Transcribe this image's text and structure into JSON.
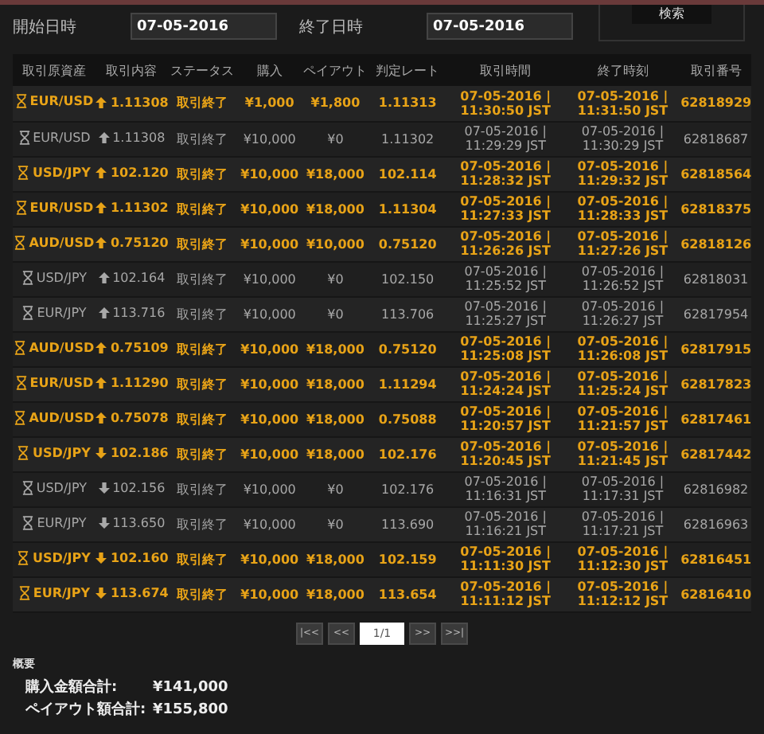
{
  "filters": [
    {
      "label": "開始日時",
      "value": "07-05-2016"
    },
    {
      "label": "終了日時",
      "value": "07-05-2016"
    }
  ],
  "search_button": "検索",
  "table": {
    "columns": [
      "取引原資産",
      "取引内容",
      "ステータス",
      "購入",
      "ペイアウト",
      "判定レート",
      "取引時間",
      "終了時刻",
      "取引番号"
    ],
    "rows": [
      {
        "won": true,
        "up": true,
        "asset": "EUR/USD",
        "strike": "1.11308",
        "status": "取引終了",
        "purchase": "¥1,000",
        "payout": "¥1,800",
        "rate": "1.11313",
        "trade_time": [
          "07-05-2016 |",
          "11:30:50 JST"
        ],
        "end_time": [
          "07-05-2016 |",
          "11:31:50 JST"
        ],
        "id": "62818929"
      },
      {
        "won": false,
        "up": true,
        "asset": "EUR/USD",
        "strike": "1.11308",
        "status": "取引終了",
        "purchase": "¥10,000",
        "payout": "¥0",
        "rate": "1.11302",
        "trade_time": [
          "07-05-2016 |",
          "11:29:29 JST"
        ],
        "end_time": [
          "07-05-2016 |",
          "11:30:29 JST"
        ],
        "id": "62818687"
      },
      {
        "won": true,
        "up": true,
        "asset": "USD/JPY",
        "strike": "102.120",
        "status": "取引終了",
        "purchase": "¥10,000",
        "payout": "¥18,000",
        "rate": "102.114",
        "trade_time": [
          "07-05-2016 |",
          "11:28:32 JST"
        ],
        "end_time": [
          "07-05-2016 |",
          "11:29:32 JST"
        ],
        "id": "62818564"
      },
      {
        "won": true,
        "up": true,
        "asset": "EUR/USD",
        "strike": "1.11302",
        "status": "取引終了",
        "purchase": "¥10,000",
        "payout": "¥18,000",
        "rate": "1.11304",
        "trade_time": [
          "07-05-2016 |",
          "11:27:33 JST"
        ],
        "end_time": [
          "07-05-2016 |",
          "11:28:33 JST"
        ],
        "id": "62818375"
      },
      {
        "won": true,
        "up": true,
        "asset": "AUD/USD",
        "strike": "0.75120",
        "status": "取引終了",
        "purchase": "¥10,000",
        "payout": "¥10,000",
        "rate": "0.75120",
        "trade_time": [
          "07-05-2016 |",
          "11:26:26 JST"
        ],
        "end_time": [
          "07-05-2016 |",
          "11:27:26 JST"
        ],
        "id": "62818126"
      },
      {
        "won": false,
        "up": true,
        "asset": "USD/JPY",
        "strike": "102.164",
        "status": "取引終了",
        "purchase": "¥10,000",
        "payout": "¥0",
        "rate": "102.150",
        "trade_time": [
          "07-05-2016 |",
          "11:25:52 JST"
        ],
        "end_time": [
          "07-05-2016 |",
          "11:26:52 JST"
        ],
        "id": "62818031"
      },
      {
        "won": false,
        "up": true,
        "asset": "EUR/JPY",
        "strike": "113.716",
        "status": "取引終了",
        "purchase": "¥10,000",
        "payout": "¥0",
        "rate": "113.706",
        "trade_time": [
          "07-05-2016 |",
          "11:25:27 JST"
        ],
        "end_time": [
          "07-05-2016 |",
          "11:26:27 JST"
        ],
        "id": "62817954"
      },
      {
        "won": true,
        "up": true,
        "asset": "AUD/USD",
        "strike": "0.75109",
        "status": "取引終了",
        "purchase": "¥10,000",
        "payout": "¥18,000",
        "rate": "0.75120",
        "trade_time": [
          "07-05-2016 |",
          "11:25:08 JST"
        ],
        "end_time": [
          "07-05-2016 |",
          "11:26:08 JST"
        ],
        "id": "62817915"
      },
      {
        "won": true,
        "up": true,
        "asset": "EUR/USD",
        "strike": "1.11290",
        "status": "取引終了",
        "purchase": "¥10,000",
        "payout": "¥18,000",
        "rate": "1.11294",
        "trade_time": [
          "07-05-2016 |",
          "11:24:24 JST"
        ],
        "end_time": [
          "07-05-2016 |",
          "11:25:24 JST"
        ],
        "id": "62817823"
      },
      {
        "won": true,
        "up": true,
        "asset": "AUD/USD",
        "strike": "0.75078",
        "status": "取引終了",
        "purchase": "¥10,000",
        "payout": "¥18,000",
        "rate": "0.75088",
        "trade_time": [
          "07-05-2016 |",
          "11:20:57 JST"
        ],
        "end_time": [
          "07-05-2016 |",
          "11:21:57 JST"
        ],
        "id": "62817461"
      },
      {
        "won": true,
        "up": false,
        "asset": "USD/JPY",
        "strike": "102.186",
        "status": "取引終了",
        "purchase": "¥10,000",
        "payout": "¥18,000",
        "rate": "102.176",
        "trade_time": [
          "07-05-2016 |",
          "11:20:45 JST"
        ],
        "end_time": [
          "07-05-2016 |",
          "11:21:45 JST"
        ],
        "id": "62817442"
      },
      {
        "won": false,
        "up": false,
        "asset": "USD/JPY",
        "strike": "102.156",
        "status": "取引終了",
        "purchase": "¥10,000",
        "payout": "¥0",
        "rate": "102.176",
        "trade_time": [
          "07-05-2016 |",
          "11:16:31 JST"
        ],
        "end_time": [
          "07-05-2016 |",
          "11:17:31 JST"
        ],
        "id": "62816982"
      },
      {
        "won": false,
        "up": false,
        "asset": "EUR/JPY",
        "strike": "113.650",
        "status": "取引終了",
        "purchase": "¥10,000",
        "payout": "¥0",
        "rate": "113.690",
        "trade_time": [
          "07-05-2016 |",
          "11:16:21 JST"
        ],
        "end_time": [
          "07-05-2016 |",
          "11:17:21 JST"
        ],
        "id": "62816963"
      },
      {
        "won": true,
        "up": false,
        "asset": "USD/JPY",
        "strike": "102.160",
        "status": "取引終了",
        "purchase": "¥10,000",
        "payout": "¥18,000",
        "rate": "102.159",
        "trade_time": [
          "07-05-2016 |",
          "11:11:30 JST"
        ],
        "end_time": [
          "07-05-2016 |",
          "11:12:30 JST"
        ],
        "id": "62816451"
      },
      {
        "won": true,
        "up": false,
        "asset": "EUR/JPY",
        "strike": "113.674",
        "status": "取引終了",
        "purchase": "¥10,000",
        "payout": "¥18,000",
        "rate": "113.654",
        "trade_time": [
          "07-05-2016 |",
          "11:11:12 JST"
        ],
        "end_time": [
          "07-05-2016 |",
          "11:12:12 JST"
        ],
        "id": "62816410"
      }
    ]
  },
  "pagination": {
    "first": "|<<",
    "prev": "<<",
    "page": "1/1",
    "next": ">>",
    "last": ">>|"
  },
  "summary": {
    "title": "概要",
    "items": [
      {
        "label": "購入金額合計:",
        "value": "¥141,000"
      },
      {
        "label": "ペイアウト額合計:",
        "value": "¥155,800"
      }
    ]
  }
}
